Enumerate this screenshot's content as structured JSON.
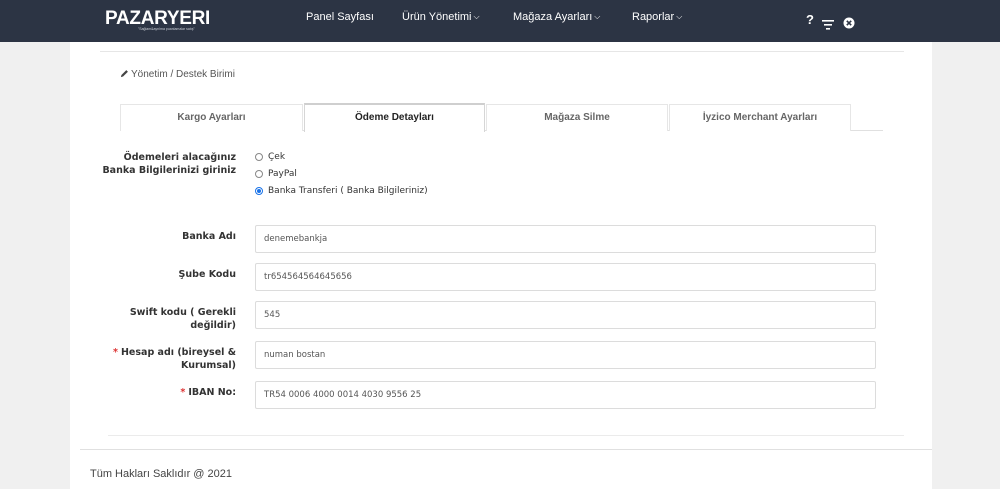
{
  "header": {
    "logo": "PAZARYERI",
    "logo_tagline": "\"Sağlam&ayrılma puanlamalar satış\"",
    "nav": [
      {
        "label": "Panel Sayfası"
      },
      {
        "label": "Ürün Yönetimi"
      },
      {
        "label": "Mağaza Ayarları"
      },
      {
        "label": "Raporlar"
      }
    ],
    "icons": [
      "help-icon",
      "filter-icon",
      "close-circle-icon"
    ],
    "help_glyph": "?"
  },
  "breadcrumb": "Yönetim / Destek Birimi",
  "tabs": [
    {
      "label": "Kargo Ayarları",
      "active": false
    },
    {
      "label": "Ödeme Detayları",
      "active": true
    },
    {
      "label": "Mağaza Silme",
      "active": false
    },
    {
      "label": "İyzico Merchant Ayarları",
      "active": false
    }
  ],
  "form": {
    "payment_label": "Ödemeleri alacağınız Banka Bilgilerinizi giriniz",
    "payment_options": [
      {
        "label": "Çek",
        "checked": false
      },
      {
        "label": "PayPal",
        "checked": false
      },
      {
        "label": "Banka Transferi ( Banka Bilgileriniz)",
        "checked": true
      }
    ],
    "fields": [
      {
        "label": "Banka Adı",
        "value": "denemebankja",
        "required": false
      },
      {
        "label": "Şube Kodu",
        "value": "tr654564564645656",
        "required": false
      },
      {
        "label": "Swift kodu ( Gerekli değildir)",
        "value": "545",
        "required": false
      },
      {
        "label": "Hesap adı (bireysel & Kurumsal)",
        "value": "numan bostan",
        "required": true
      },
      {
        "label": "IBAN No:",
        "value": "TR54 0006 4000 0014 4030 9556 25",
        "required": true
      }
    ],
    "required_mark": "*"
  },
  "footer": "Tüm Hakları Saklıdır @ 2021",
  "colors": {
    "navbar": "#2c3444",
    "radio_accent": "#1a73e8",
    "required": "#dd3333"
  }
}
